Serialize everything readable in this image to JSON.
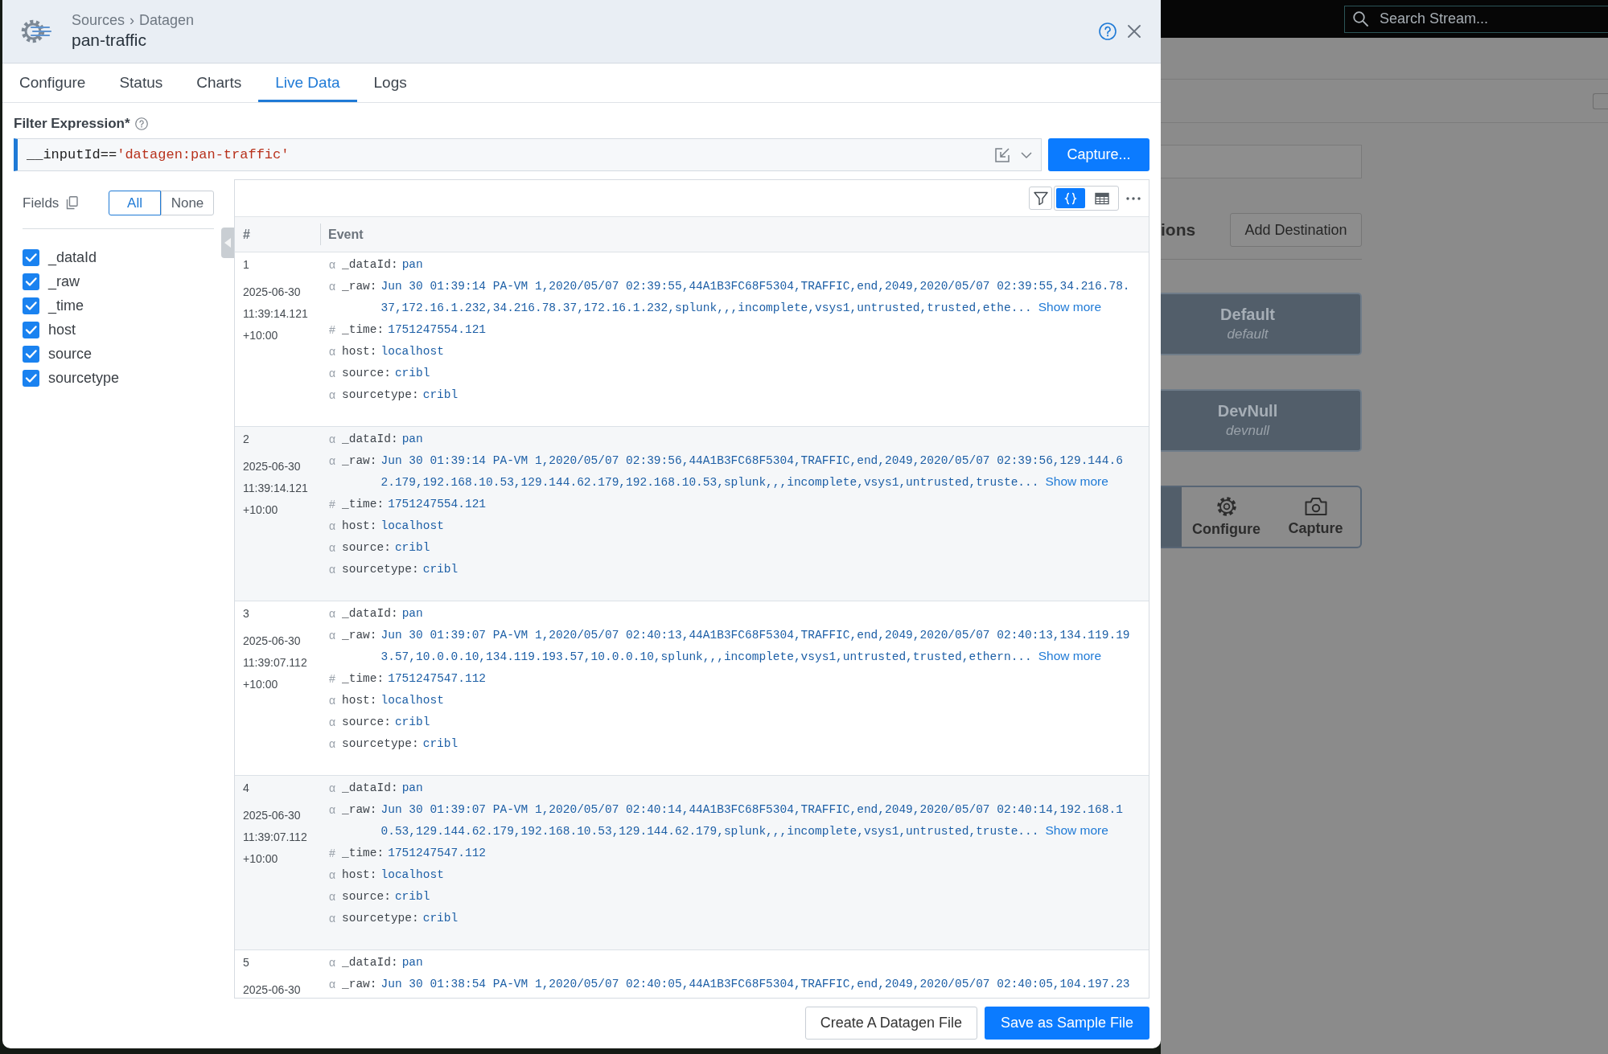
{
  "header": {
    "breadcrumb": [
      "Sources",
      "Datagen"
    ],
    "separator": "›",
    "title": "pan-traffic"
  },
  "tabs": [
    {
      "label": "Configure",
      "selected": false
    },
    {
      "label": "Status",
      "selected": false
    },
    {
      "label": "Charts",
      "selected": false
    },
    {
      "label": "Live Data",
      "selected": true
    },
    {
      "label": "Logs",
      "selected": false
    }
  ],
  "filter": {
    "label": "Filter Expression*",
    "tokens": [
      {
        "text": "__inputId==",
        "kind": "code"
      },
      {
        "text": "'datagen:pan-traffic'",
        "kind": "string"
      }
    ],
    "button": "Capture..."
  },
  "fields_panel": {
    "label": "Fields",
    "toggle": [
      {
        "label": "All",
        "selected": true
      },
      {
        "label": "None",
        "selected": false
      }
    ],
    "fields": [
      {
        "name": "_dataId",
        "checked": true
      },
      {
        "name": "_raw",
        "checked": true
      },
      {
        "name": "_time",
        "checked": true
      },
      {
        "name": "host",
        "checked": true
      },
      {
        "name": "source",
        "checked": true
      },
      {
        "name": "sourcetype",
        "checked": true
      }
    ]
  },
  "events": {
    "view_modes": [
      {
        "kind": "json",
        "selected": true
      },
      {
        "kind": "table",
        "selected": false
      }
    ],
    "columns": [
      "#",
      "Event"
    ],
    "rows": [
      {
        "number": "1",
        "timestamp": "2025-06-30 11:39:14.121 +10:00",
        "fields": [
          {
            "glyph": "α",
            "key": "_dataId:",
            "value": "pan"
          },
          {
            "glyph": "α",
            "key": "_raw:",
            "value": "Jun 30 01:39:14 PA-VM 1,2020/05/07 02:39:55,44A1B3FC68F5304,TRAFFIC,end,2049,2020/05/07 02:39:55,34.216.78.37,172.16.1.232,34.216.78.37,172.16.1.232,splunk,,,incomplete,vsys1,untrusted,trusted,ethe...",
            "more": "Show more"
          },
          {
            "glyph": "#",
            "key": "_time:",
            "value": "1751247554.121"
          },
          {
            "glyph": "α",
            "key": "host:",
            "value": "localhost"
          },
          {
            "glyph": "α",
            "key": "source:",
            "value": "cribl"
          },
          {
            "glyph": "α",
            "key": "sourcetype:",
            "value": "cribl"
          }
        ]
      },
      {
        "number": "2",
        "timestamp": "2025-06-30 11:39:14.121 +10:00",
        "fields": [
          {
            "glyph": "α",
            "key": "_dataId:",
            "value": "pan"
          },
          {
            "glyph": "α",
            "key": "_raw:",
            "value": "Jun 30 01:39:14 PA-VM 1,2020/05/07 02:39:56,44A1B3FC68F5304,TRAFFIC,end,2049,2020/05/07 02:39:56,129.144.62.179,192.168.10.53,129.144.62.179,192.168.10.53,splunk,,,incomplete,vsys1,untrusted,truste...",
            "more": "Show more"
          },
          {
            "glyph": "#",
            "key": "_time:",
            "value": "1751247554.121"
          },
          {
            "glyph": "α",
            "key": "host:",
            "value": "localhost"
          },
          {
            "glyph": "α",
            "key": "source:",
            "value": "cribl"
          },
          {
            "glyph": "α",
            "key": "sourcetype:",
            "value": "cribl"
          }
        ]
      },
      {
        "number": "3",
        "timestamp": "2025-06-30 11:39:07.112 +10:00",
        "fields": [
          {
            "glyph": "α",
            "key": "_dataId:",
            "value": "pan"
          },
          {
            "glyph": "α",
            "key": "_raw:",
            "value": "Jun 30 01:39:07 PA-VM 1,2020/05/07 02:40:13,44A1B3FC68F5304,TRAFFIC,end,2049,2020/05/07 02:40:13,134.119.193.57,10.0.0.10,134.119.193.57,10.0.0.10,splunk,,,incomplete,vsys1,untrusted,trusted,ethern...",
            "more": "Show more"
          },
          {
            "glyph": "#",
            "key": "_time:",
            "value": "1751247547.112"
          },
          {
            "glyph": "α",
            "key": "host:",
            "value": "localhost"
          },
          {
            "glyph": "α",
            "key": "source:",
            "value": "cribl"
          },
          {
            "glyph": "α",
            "key": "sourcetype:",
            "value": "cribl"
          }
        ]
      },
      {
        "number": "4",
        "timestamp": "2025-06-30 11:39:07.112 +10:00",
        "fields": [
          {
            "glyph": "α",
            "key": "_dataId:",
            "value": "pan"
          },
          {
            "glyph": "α",
            "key": "_raw:",
            "value": "Jun 30 01:39:07 PA-VM 1,2020/05/07 02:40:14,44A1B3FC68F5304,TRAFFIC,end,2049,2020/05/07 02:40:14,192.168.10.53,129.144.62.179,192.168.10.53,129.144.62.179,splunk,,,incomplete,vsys1,untrusted,truste...",
            "more": "Show more"
          },
          {
            "glyph": "#",
            "key": "_time:",
            "value": "1751247547.112"
          },
          {
            "glyph": "α",
            "key": "host:",
            "value": "localhost"
          },
          {
            "glyph": "α",
            "key": "source:",
            "value": "cribl"
          },
          {
            "glyph": "α",
            "key": "sourcetype:",
            "value": "cribl"
          }
        ]
      },
      {
        "number": "5",
        "timestamp": "2025-06-30",
        "fields": [
          {
            "glyph": "α",
            "key": "_dataId:",
            "value": "pan"
          },
          {
            "glyph": "α",
            "key": "_raw:",
            "value": "Jun 30 01:38:54 PA-VM 1,2020/05/07 02:40:05,44A1B3FC68F5304,TRAFFIC,end,2049,2020/05/07 02:40:05,104.197.23"
          }
        ]
      }
    ]
  },
  "footer": {
    "buttons": [
      {
        "label": "Create A Datagen File",
        "kind": "secondary"
      },
      {
        "label": "Save as Sample File",
        "kind": "primary"
      }
    ]
  },
  "background": {
    "search": {
      "placeholder": "Search Stream..."
    },
    "heading": "ions",
    "add_button": "Add Destination",
    "destinations": [
      {
        "name": "Default",
        "id": "default"
      },
      {
        "name": "DevNull",
        "id": "devnull"
      }
    ],
    "actions": [
      {
        "label": "Configure",
        "kind": "configure"
      },
      {
        "label": "Capture",
        "kind": "capture"
      }
    ]
  }
}
